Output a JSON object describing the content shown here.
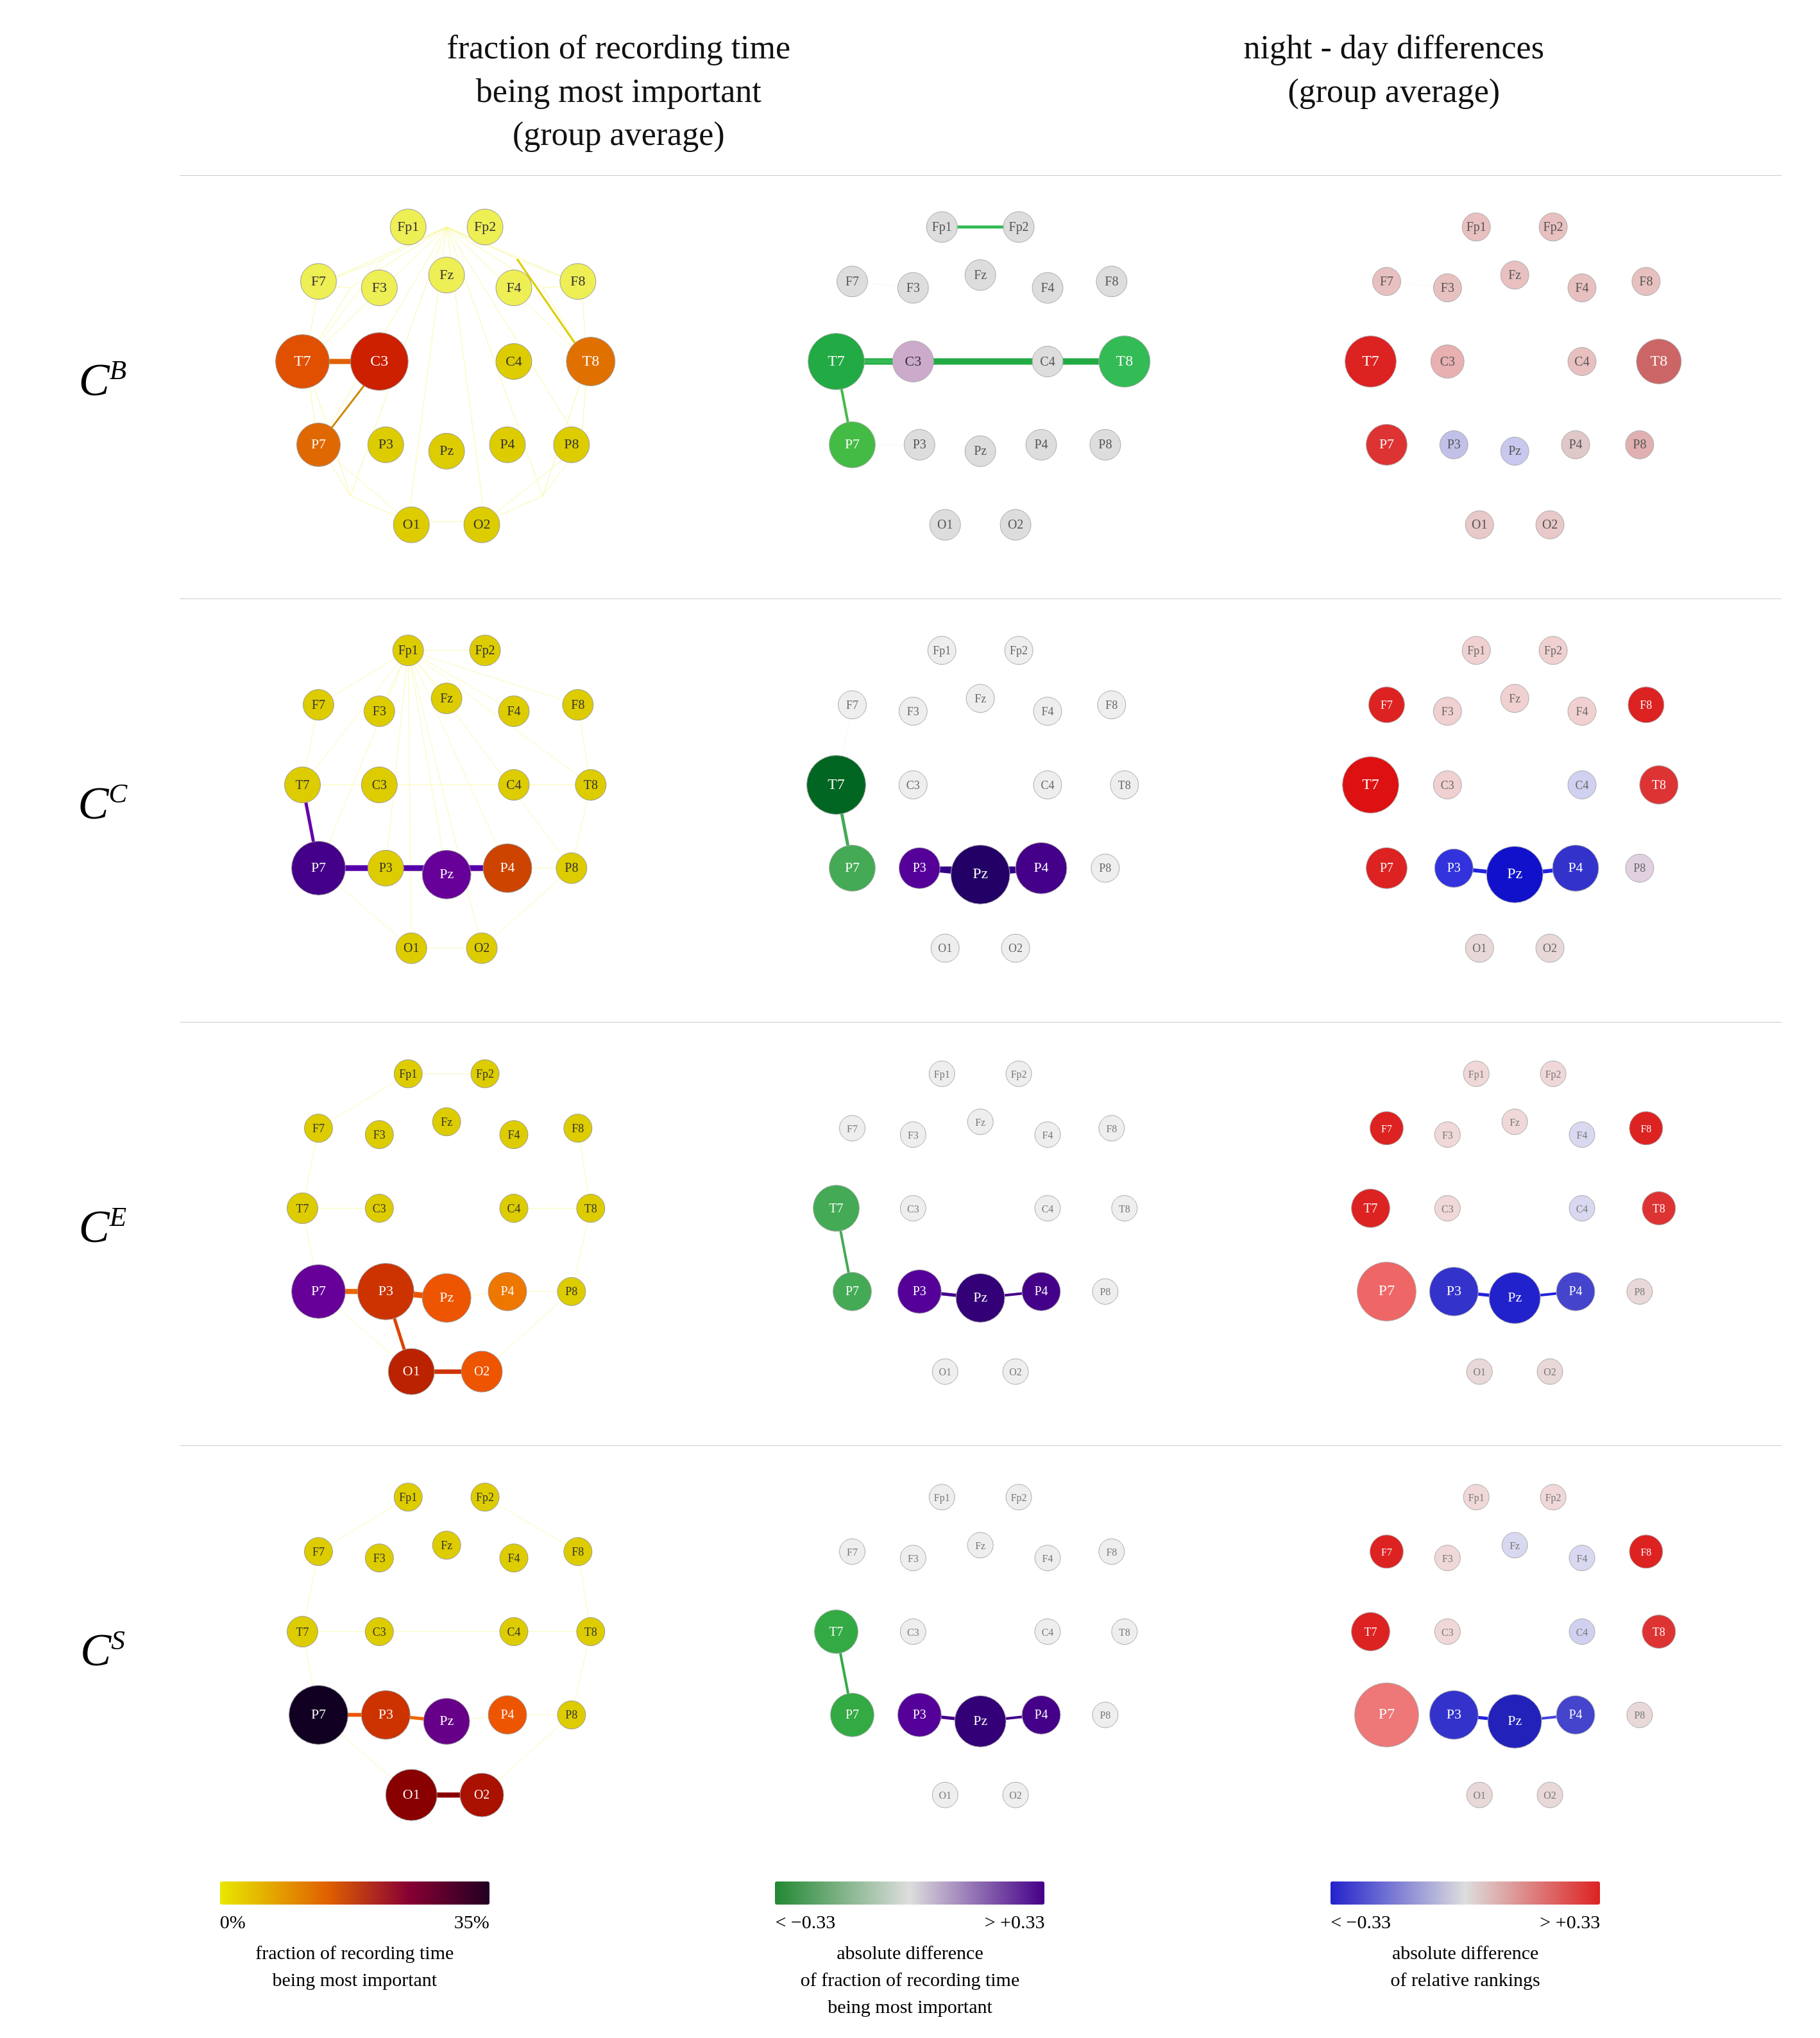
{
  "header": {
    "left_title": "fraction of recording time\nbeing most important\n(group average)",
    "right_title": "night - day differences\n(group average)"
  },
  "rows": [
    {
      "label": "C",
      "superscript": "B"
    },
    {
      "label": "C",
      "superscript": "C"
    },
    {
      "label": "C",
      "superscript": "E"
    },
    {
      "label": "C",
      "superscript": "S"
    }
  ],
  "legends": [
    {
      "gradient_type": "yellow_dark",
      "left": "0%",
      "right": "35%",
      "text": "fraction of recording time\nbeing most important"
    },
    {
      "gradient_type": "green_purple",
      "left": "< −0.33",
      "right": "> +0.33",
      "text": "absolute difference\nof fraction of recording time\nbeing most important"
    },
    {
      "gradient_type": "blue_red",
      "left": "< −0.33",
      "right": "> +0.33",
      "text": "absolute difference\nof relative rankings"
    }
  ]
}
